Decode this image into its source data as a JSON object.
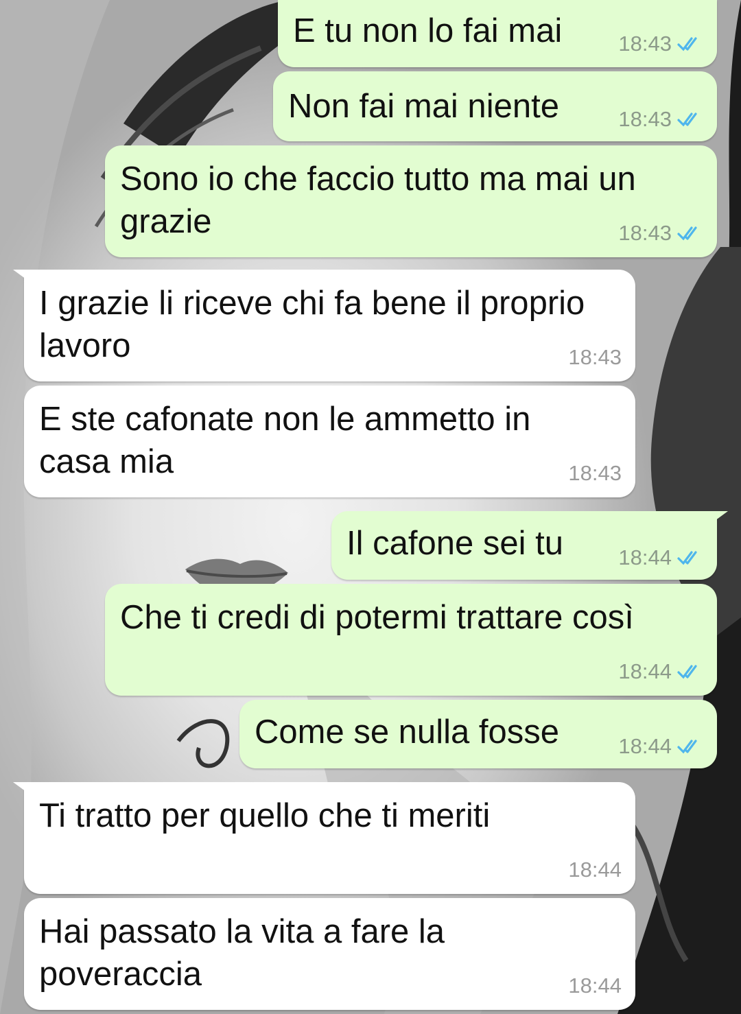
{
  "messages": [
    {
      "direction": "out",
      "text": "E tu non lo fai mai",
      "time": "18:43",
      "status_icon": "double-check-icon"
    },
    {
      "direction": "out",
      "text": "Non fai mai niente",
      "time": "18:43",
      "status_icon": "double-check-icon"
    },
    {
      "direction": "out",
      "text": "Sono io che faccio tutto ma mai un\ngrazie",
      "time": "18:43",
      "status_icon": "double-check-icon"
    },
    {
      "direction": "in",
      "text": "I grazie li riceve chi fa bene il proprio\nlavoro",
      "time": "18:43"
    },
    {
      "direction": "in",
      "text": "E ste cafonate non le ammetto in\ncasa mia",
      "time": "18:43"
    },
    {
      "direction": "out",
      "text": "Il cafone sei tu",
      "time": "18:44",
      "status_icon": "double-check-icon"
    },
    {
      "direction": "out",
      "text": "Che ti credi di potermi trattare così",
      "time": "18:44",
      "status_icon": "double-check-icon"
    },
    {
      "direction": "out",
      "text": "Come se nulla fosse",
      "time": "18:44",
      "status_icon": "double-check-icon"
    },
    {
      "direction": "in",
      "text": "Ti tratto per quello che ti meriti",
      "time": "18:44"
    },
    {
      "direction": "in",
      "text": "Hai passato la vita a fare la\npoveraccia",
      "time": "18:44"
    }
  ],
  "colors": {
    "outgoing_bubble": "#e2fdd1",
    "incoming_bubble": "#ffffff",
    "read_ticks": "#4fb6ec"
  }
}
